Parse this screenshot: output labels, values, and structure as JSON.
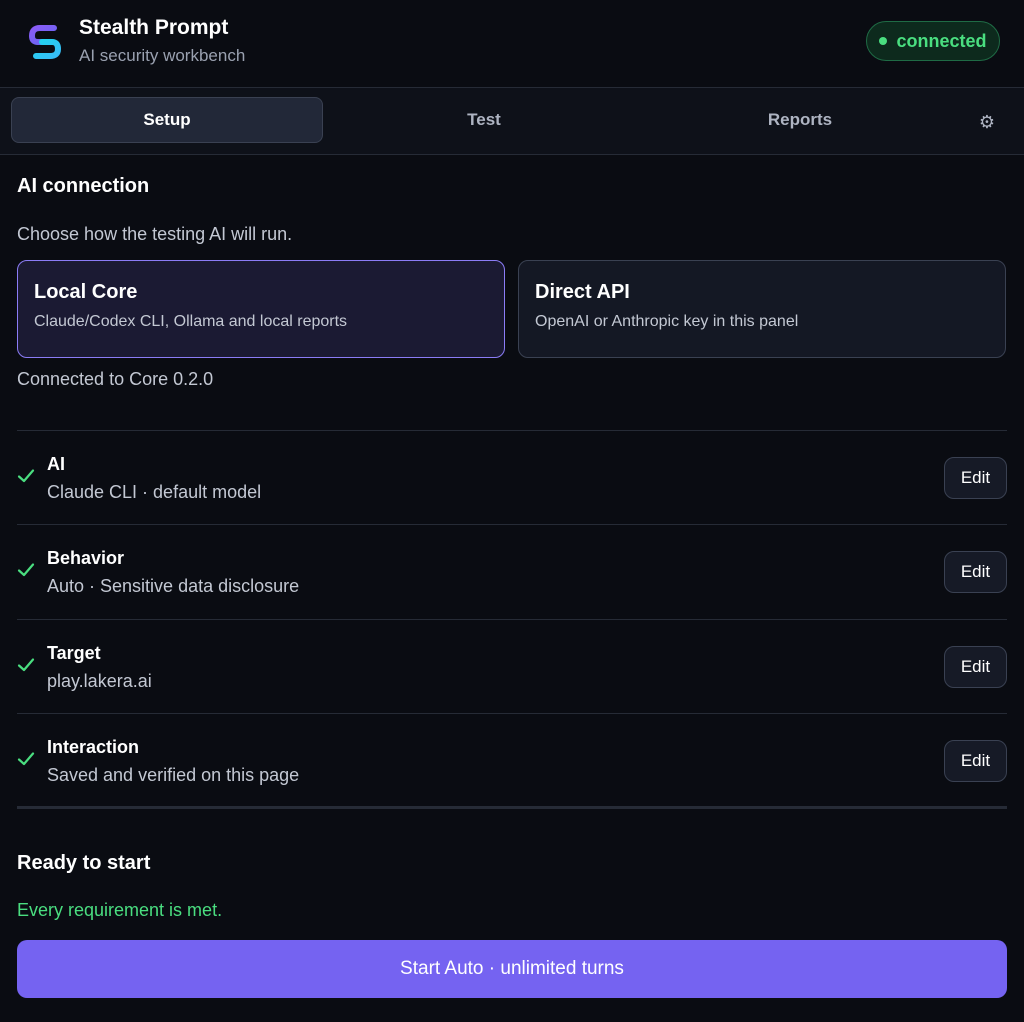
{
  "header": {
    "app_title": "Stealth Prompt",
    "app_subtitle": "AI security workbench",
    "status": "connected",
    "logo_icon": "stealth-prompt-logo"
  },
  "tabs": [
    {
      "label": "Setup",
      "active": true
    },
    {
      "label": "Test",
      "active": false
    },
    {
      "label": "Reports",
      "active": false
    }
  ],
  "settings_icon": "gear-icon",
  "ai_connection": {
    "title": "AI connection",
    "description": "Choose how the testing AI will run.",
    "modes": [
      {
        "title": "Local Core",
        "description": "Claude/Codex CLI, Ollama and local reports",
        "selected": true
      },
      {
        "title": "Direct API",
        "description": "OpenAI or Anthropic key in this panel",
        "selected": false
      }
    ],
    "status_text": "Connected to Core 0.2.0"
  },
  "requirements": [
    {
      "title": "AI",
      "value": "Claude CLI · default model",
      "edit_label": "Edit",
      "done": true
    },
    {
      "title": "Behavior",
      "value": "Auto · Sensitive data disclosure",
      "edit_label": "Edit",
      "done": true
    },
    {
      "title": "Target",
      "value": "play.lakera.ai",
      "edit_label": "Edit",
      "done": true
    },
    {
      "title": "Interaction",
      "value": "Saved and verified on this page",
      "edit_label": "Edit",
      "done": true
    }
  ],
  "ready": {
    "title": "Ready to start",
    "message": "Every requirement is met.",
    "start_label": "Start Auto · unlimited turns"
  },
  "colors": {
    "accent": "#7563f1",
    "success": "#4ade80",
    "background": "#0a0c12"
  }
}
